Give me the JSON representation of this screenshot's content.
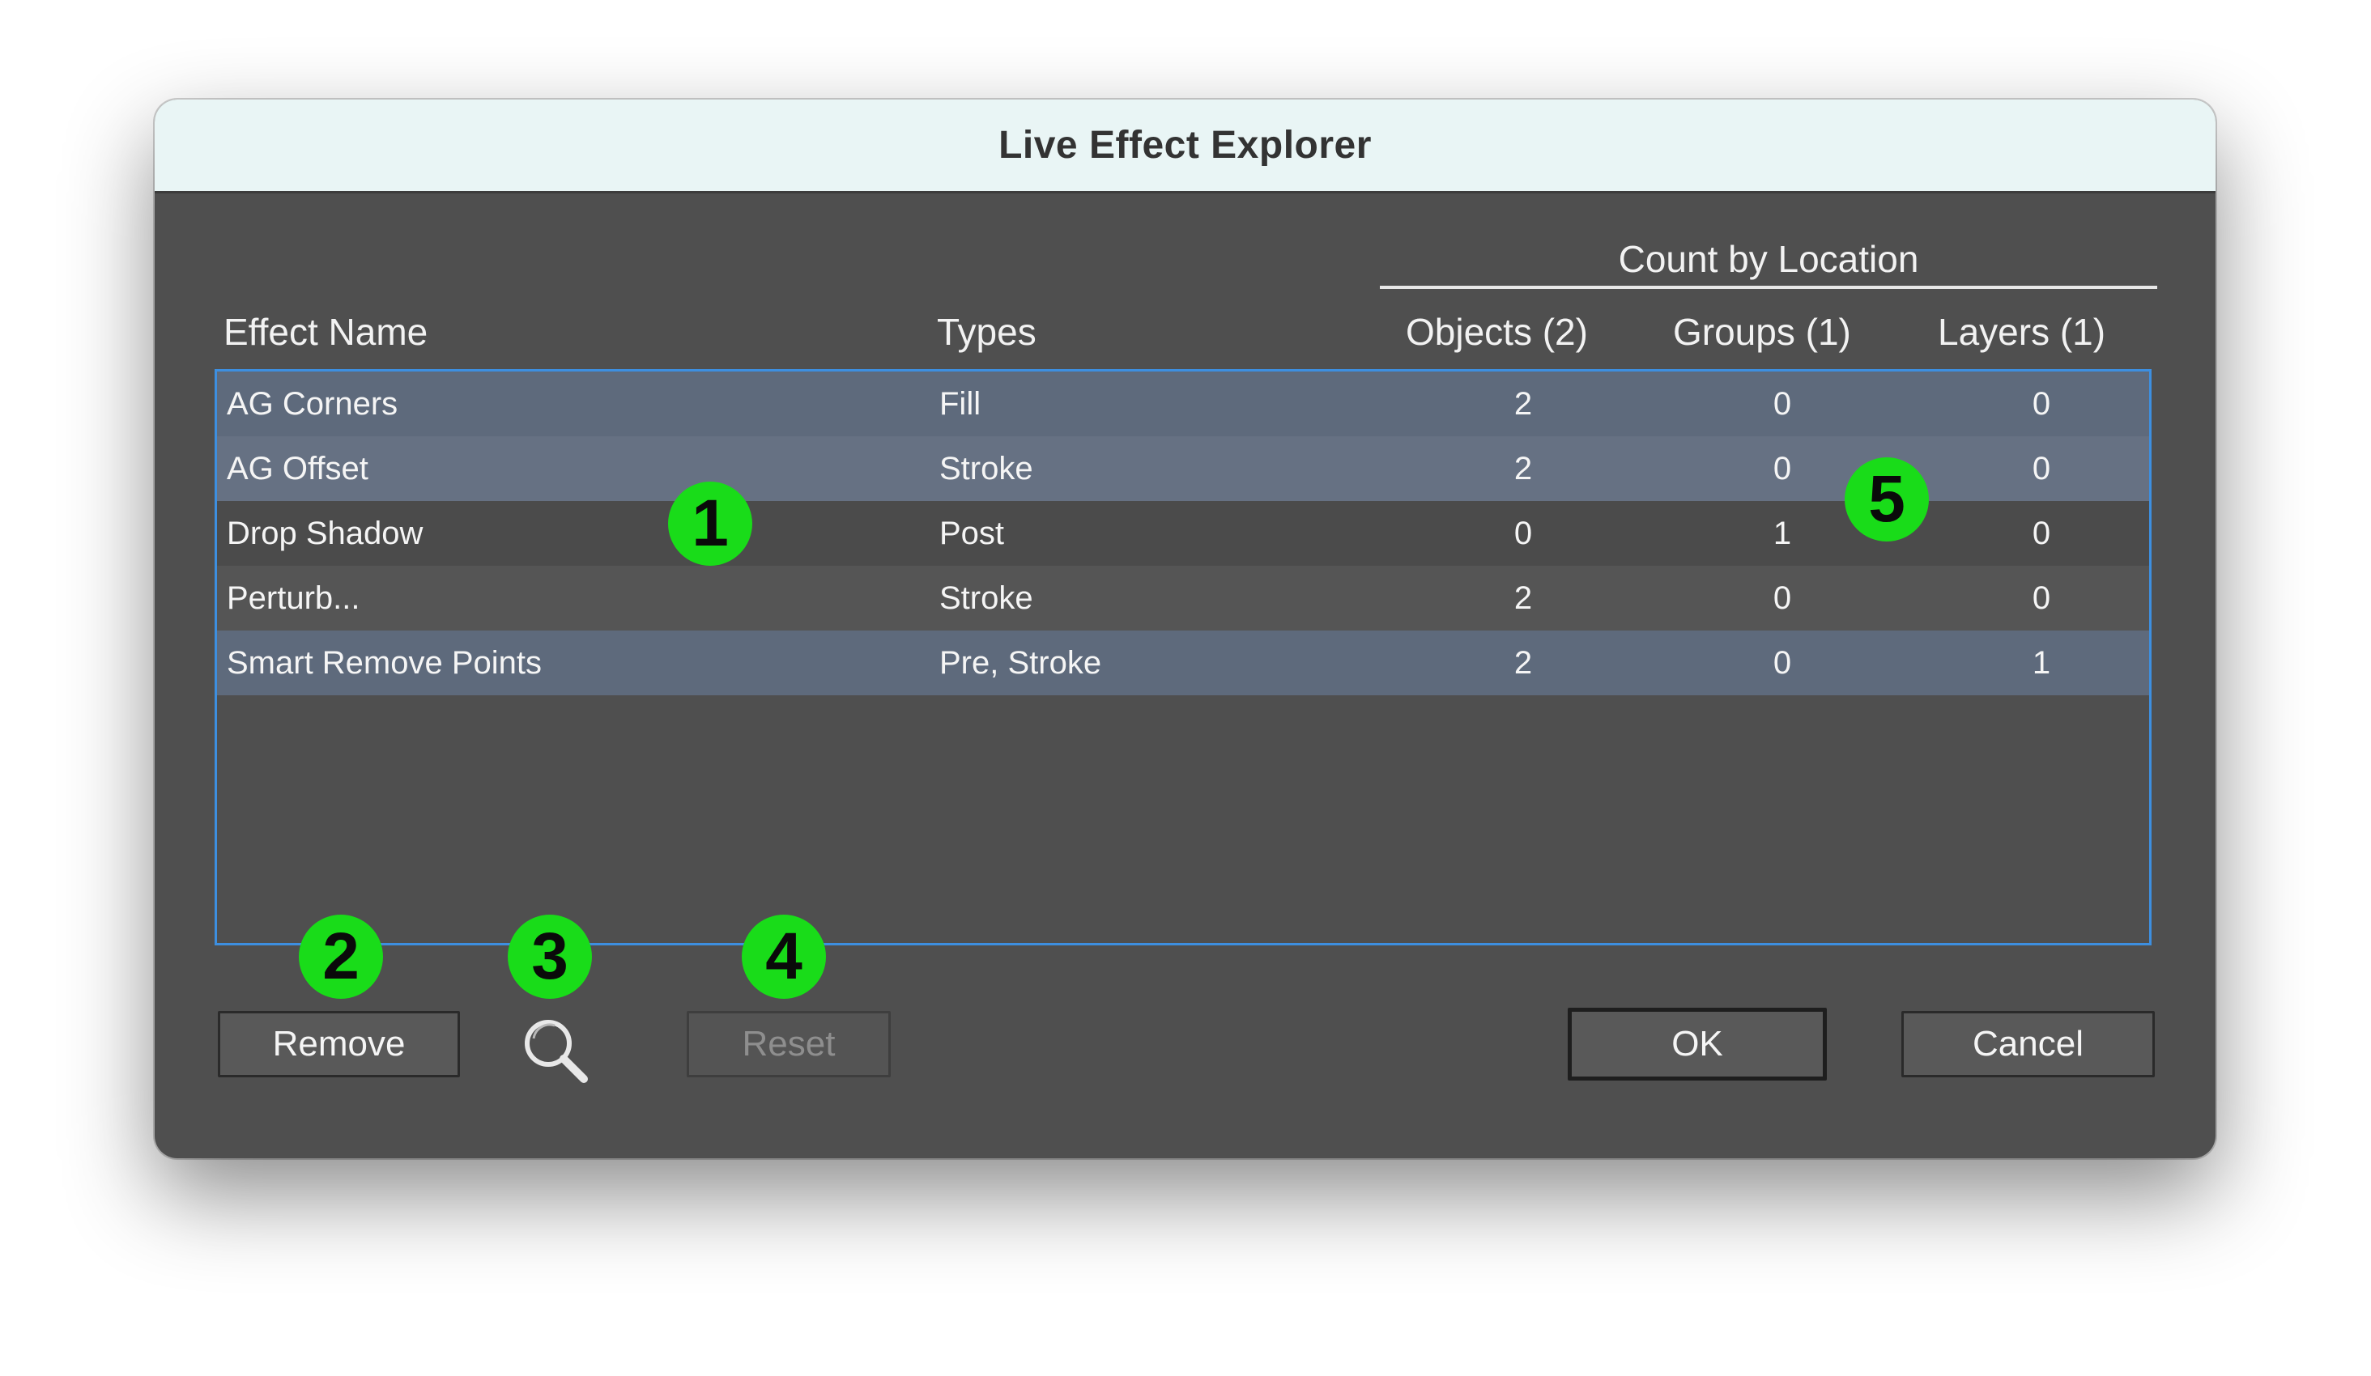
{
  "window": {
    "title": "Live Effect Explorer"
  },
  "table": {
    "group_header": "Count by Location",
    "headers": {
      "name": "Effect Name",
      "types": "Types",
      "objects": "Objects (2)",
      "groups": "Groups (1)",
      "layers": "Layers (1)"
    },
    "rows": [
      {
        "name": "AG Corners",
        "types": "Fill",
        "objects": "2",
        "groups": "0",
        "layers": "0",
        "selected": true
      },
      {
        "name": "AG Offset",
        "types": "Stroke",
        "objects": "2",
        "groups": "0",
        "layers": "0",
        "selected": true
      },
      {
        "name": "Drop Shadow",
        "types": "Post",
        "objects": "0",
        "groups": "1",
        "layers": "0",
        "selected": false
      },
      {
        "name": "Perturb...",
        "types": "Stroke",
        "objects": "2",
        "groups": "0",
        "layers": "0",
        "selected": false
      },
      {
        "name": "Smart Remove Points",
        "types": "Pre, Stroke",
        "objects": "2",
        "groups": "0",
        "layers": "1",
        "selected": true
      }
    ]
  },
  "buttons": {
    "remove": "Remove",
    "reset": "Reset",
    "ok": "OK",
    "cancel": "Cancel"
  },
  "icons": {
    "zoom": "magnifier-icon"
  },
  "annotations": [
    "1",
    "2",
    "3",
    "4",
    "5"
  ],
  "colors": {
    "selection": "#5e6a7c",
    "focus_ring": "#3d8fe0",
    "marker": "#19dc19",
    "titlebar": "#e9f5f5"
  }
}
